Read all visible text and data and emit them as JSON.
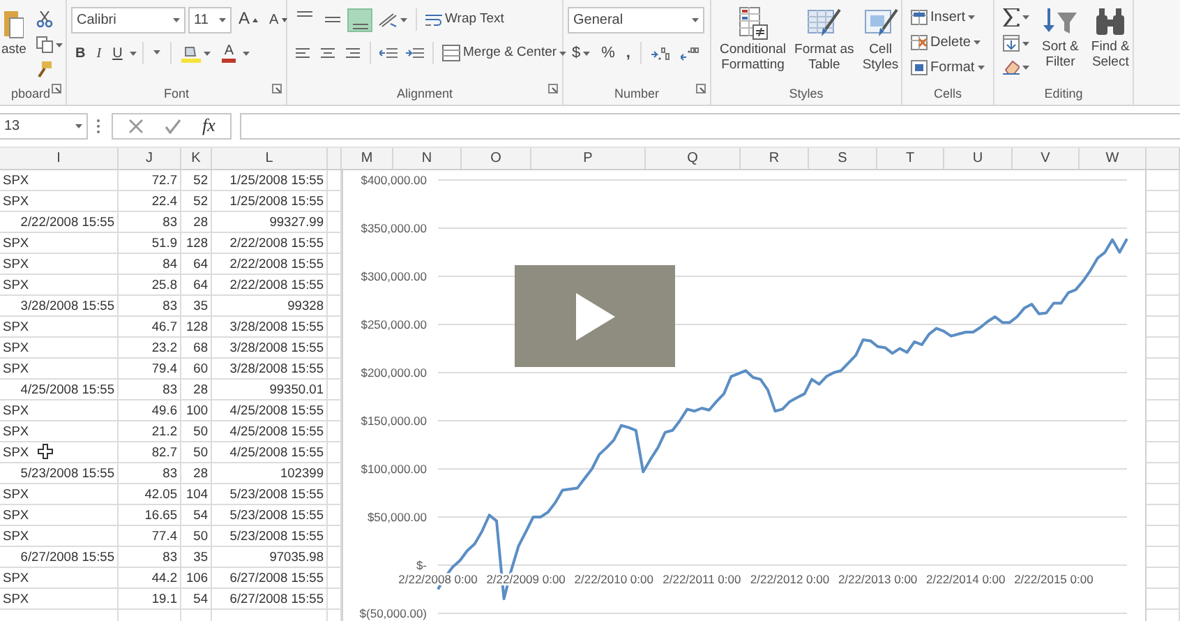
{
  "ribbon": {
    "clipboard": {
      "paste_label": "aste",
      "group_label": "pboard"
    },
    "font": {
      "font_name": "Calibri",
      "font_size": "11",
      "grow_label": "A",
      "shrink_label": "A",
      "style_buttons": [
        {
          "label": "B",
          "kind": "bold"
        },
        {
          "label": "I",
          "kind": "italic"
        },
        {
          "label": "U",
          "kind": "underline"
        }
      ],
      "font_color_label": "A",
      "group_label": "Font"
    },
    "alignment": {
      "vertical_buttons": [
        {
          "kind": "top",
          "selected": false
        },
        {
          "kind": "middle",
          "selected": false
        },
        {
          "kind": "bottom",
          "selected": true
        }
      ],
      "wrap_text": "Wrap Text",
      "merge_center": "Merge & Center",
      "group_label": "Alignment"
    },
    "number": {
      "format": "General",
      "currency": "$",
      "percent": "%",
      "comma": ",",
      "group_label": "Number"
    },
    "styles": {
      "buttons": [
        {
          "kind": "conditional",
          "lines": [
            "Conditional",
            "Formatting"
          ]
        },
        {
          "kind": "table",
          "lines": [
            "Format as",
            "Table"
          ]
        },
        {
          "kind": "cell",
          "lines": [
            "Cell",
            "Styles"
          ]
        }
      ],
      "group_label": "Styles"
    },
    "cells": {
      "buttons": [
        {
          "kind": "insert",
          "label": "Insert"
        },
        {
          "kind": "delete",
          "label": "Delete"
        },
        {
          "kind": "format",
          "label": "Format"
        }
      ],
      "group_label": "Cells"
    },
    "editing": {
      "buttons": [
        {
          "kind": "sort",
          "lines": [
            "Sort &",
            "Filter"
          ]
        },
        {
          "kind": "find",
          "lines": [
            "Find &",
            "Select"
          ]
        }
      ],
      "group_label": "Editing"
    }
  },
  "formula_bar": {
    "name_box": "13",
    "function_label": "fx"
  },
  "sheet": {
    "columns": [
      "I",
      "J",
      "K",
      "L"
    ],
    "chart_columns": [
      "M",
      "N",
      "O",
      "P",
      "Q",
      "R",
      "S",
      "T",
      "U",
      "V",
      "W"
    ],
    "rows": [
      {
        "kind": "trade",
        "cells": [
          "SPX",
          "72.7",
          "52",
          "1/25/2008 15:55"
        ]
      },
      {
        "kind": "trade",
        "cells": [
          "SPX",
          "22.4",
          "52",
          "1/25/2008 15:55"
        ]
      },
      {
        "kind": "summary",
        "cells": [
          "2/22/2008 15:55",
          "83",
          "28",
          "99327.99"
        ]
      },
      {
        "kind": "trade",
        "cells": [
          "SPX",
          "51.9",
          "128",
          "2/22/2008 15:55"
        ]
      },
      {
        "kind": "trade",
        "cells": [
          "SPX",
          "84",
          "64",
          "2/22/2008 15:55"
        ]
      },
      {
        "kind": "trade",
        "cells": [
          "SPX",
          "25.8",
          "64",
          "2/22/2008 15:55"
        ]
      },
      {
        "kind": "summary",
        "cells": [
          "3/28/2008 15:55",
          "83",
          "35",
          "99328"
        ]
      },
      {
        "kind": "trade",
        "cells": [
          "SPX",
          "46.7",
          "128",
          "3/28/2008 15:55"
        ]
      },
      {
        "kind": "trade",
        "cells": [
          "SPX",
          "23.2",
          "68",
          "3/28/2008 15:55"
        ]
      },
      {
        "kind": "trade",
        "cells": [
          "SPX",
          "79.4",
          "60",
          "3/28/2008 15:55"
        ]
      },
      {
        "kind": "summary",
        "cells": [
          "4/25/2008 15:55",
          "83",
          "28",
          "99350.01"
        ]
      },
      {
        "kind": "trade",
        "cells": [
          "SPX",
          "49.6",
          "100",
          "4/25/2008 15:55"
        ]
      },
      {
        "kind": "trade",
        "cells": [
          "SPX",
          "21.2",
          "50",
          "4/25/2008 15:55"
        ]
      },
      {
        "kind": "trade",
        "cells": [
          "SPX",
          "82.7",
          "50",
          "4/25/2008 15:55"
        ]
      },
      {
        "kind": "summary",
        "cells": [
          "5/23/2008 15:55",
          "83",
          "28",
          "102399"
        ]
      },
      {
        "kind": "trade",
        "cells": [
          "SPX",
          "42.05",
          "104",
          "5/23/2008 15:55"
        ]
      },
      {
        "kind": "trade",
        "cells": [
          "SPX",
          "16.65",
          "54",
          "5/23/2008 15:55"
        ]
      },
      {
        "kind": "trade",
        "cells": [
          "SPX",
          "77.4",
          "50",
          "5/23/2008 15:55"
        ]
      },
      {
        "kind": "summary",
        "cells": [
          "6/27/2008 15:55",
          "83",
          "35",
          "97035.98"
        ]
      },
      {
        "kind": "trade",
        "cells": [
          "SPX",
          "44.2",
          "106",
          "6/27/2008 15:55"
        ]
      },
      {
        "kind": "trade",
        "cells": [
          "SPX",
          "19.1",
          "54",
          "6/27/2008 15:55"
        ]
      }
    ]
  },
  "chart": {
    "chart_data": {
      "type": "line",
      "categories": [
        "2/22/2008 0:00",
        null,
        null,
        null,
        null,
        null,
        null,
        null,
        null,
        null,
        null,
        null,
        "2/22/2009 0:00",
        null,
        null,
        null,
        null,
        null,
        null,
        null,
        null,
        null,
        null,
        null,
        "2/22/2010 0:00",
        null,
        null,
        null,
        null,
        null,
        null,
        null,
        null,
        null,
        null,
        null,
        "2/22/2011 0:00",
        null,
        null,
        null,
        null,
        null,
        null,
        null,
        null,
        null,
        null,
        null,
        "2/22/2012 0:00",
        null,
        null,
        null,
        null,
        null,
        null,
        null,
        null,
        null,
        null,
        null,
        "2/22/2013 0:00",
        null,
        null,
        null,
        null,
        null,
        null,
        null,
        null,
        null,
        null,
        null,
        "2/22/2014 0:00",
        null,
        null,
        null,
        null,
        null,
        null,
        null,
        null,
        null,
        null,
        null,
        "2/22/2015 0:00",
        null,
        null,
        null,
        null,
        null,
        null,
        null,
        null,
        null,
        null
      ],
      "series": [
        {
          "color": "#5b8ec4",
          "values": [
            -25000,
            -12000,
            -2000,
            5000,
            15000,
            22000,
            35000,
            52000,
            46000,
            -35000,
            -5000,
            20000,
            35000,
            50000,
            50000,
            55000,
            65000,
            78000,
            79000,
            80000,
            90000,
            100000,
            115000,
            122000,
            130000,
            145000,
            143000,
            140000,
            97000,
            110000,
            122000,
            138000,
            140000,
            150000,
            162000,
            160000,
            163000,
            161000,
            170000,
            178000,
            196000,
            199000,
            202000,
            195000,
            193000,
            182000,
            160000,
            162000,
            170000,
            174000,
            178000,
            193000,
            188000,
            196000,
            200000,
            202000,
            210000,
            218000,
            234000,
            233000,
            227000,
            226000,
            220000,
            225000,
            221000,
            232000,
            229000,
            240000,
            246000,
            243000,
            238000,
            240000,
            242000,
            242000,
            247000,
            253000,
            258000,
            252000,
            252000,
            258000,
            267000,
            271000,
            261000,
            262000,
            272000,
            272000,
            283000,
            286000,
            295000,
            306000,
            319000,
            325000,
            338000,
            325000,
            339000
          ]
        }
      ],
      "ylim": [
        -50000,
        400000
      ],
      "grid": true,
      "yticks": [
        {
          "value": -50000,
          "label": "$(50,000.00)"
        },
        {
          "value": 0,
          "label": "$-"
        },
        {
          "value": 50000,
          "label": "$50,000.00"
        },
        {
          "value": 100000,
          "label": "$100,000.00"
        },
        {
          "value": 150000,
          "label": "$150,000.00"
        },
        {
          "value": 200000,
          "label": "$200,000.00"
        },
        {
          "value": 250000,
          "label": "$250,000.00"
        },
        {
          "value": 300000,
          "label": "$300,000.00"
        },
        {
          "value": 350000,
          "label": "$350,000.00"
        },
        {
          "value": 400000,
          "label": "$400,000.00"
        }
      ]
    }
  }
}
